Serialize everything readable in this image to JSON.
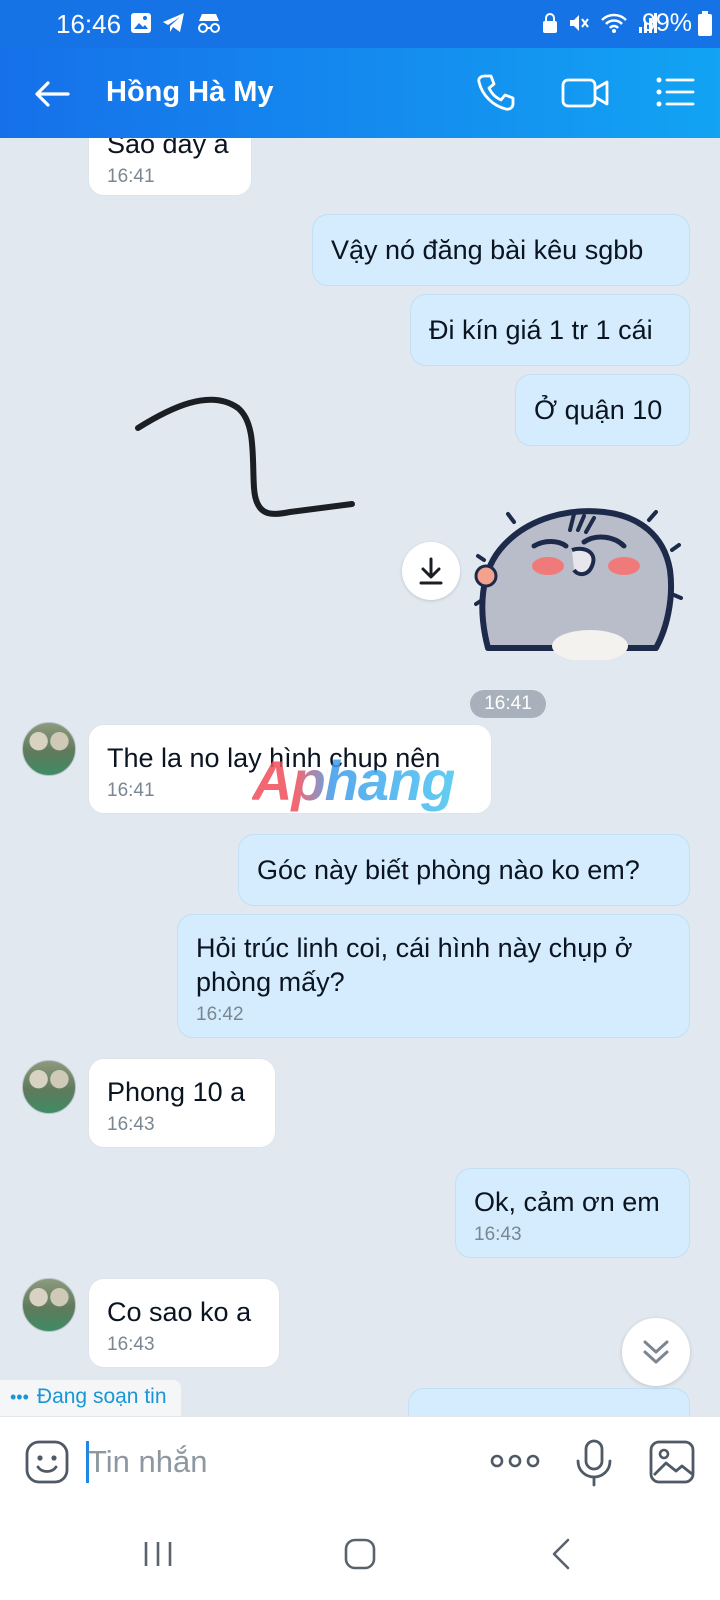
{
  "status_bar": {
    "time": "16:46",
    "battery": "99%",
    "left_icons": [
      "gallery-icon",
      "telegram-icon",
      "incognito-icon"
    ],
    "right_icons": [
      "lock-icon",
      "mute-icon",
      "wifi-icon",
      "signal-icon",
      "battery-icon"
    ]
  },
  "header": {
    "title": "Hồng Hà My",
    "icons": [
      "back-arrow-icon",
      "phone-icon",
      "video-call-icon",
      "menu-list-icon"
    ]
  },
  "messages": [
    {
      "direction": "in",
      "text": "Sao day a",
      "time": "16:41"
    },
    {
      "direction": "out",
      "text": "Vậy nó đăng bài kêu sgbb"
    },
    {
      "direction": "out",
      "text": "Đi kín giá 1 tr 1 cái"
    },
    {
      "direction": "out",
      "text": "Ở quận 10"
    },
    {
      "direction": "out",
      "type": "sticker",
      "time": "16:41"
    },
    {
      "direction": "in",
      "text": "The la no lay hình chup nên",
      "time": "16:41"
    },
    {
      "direction": "out",
      "text": "Góc này biết phòng nào ko em?"
    },
    {
      "direction": "out",
      "text": "Hỏi trúc linh coi, cái hình này chụp ở phòng mấy?",
      "time": "16:42"
    },
    {
      "direction": "in",
      "text": "Phong 10 a",
      "time": "16:43"
    },
    {
      "direction": "out",
      "text": "Ok, cảm ơn em",
      "time": "16:43"
    },
    {
      "direction": "in",
      "text": "Co sao ko a",
      "time": "16:43"
    }
  ],
  "watermark": "Aphang",
  "typing_indicator": "Đang soạn tin",
  "composer": {
    "placeholder": "Tin nhắn"
  },
  "colors": {
    "header": "#1670ea",
    "outgoing_bubble": "#d4ecfd",
    "incoming_bubble": "#ffffff",
    "chat_background": "#e2e8f0"
  }
}
